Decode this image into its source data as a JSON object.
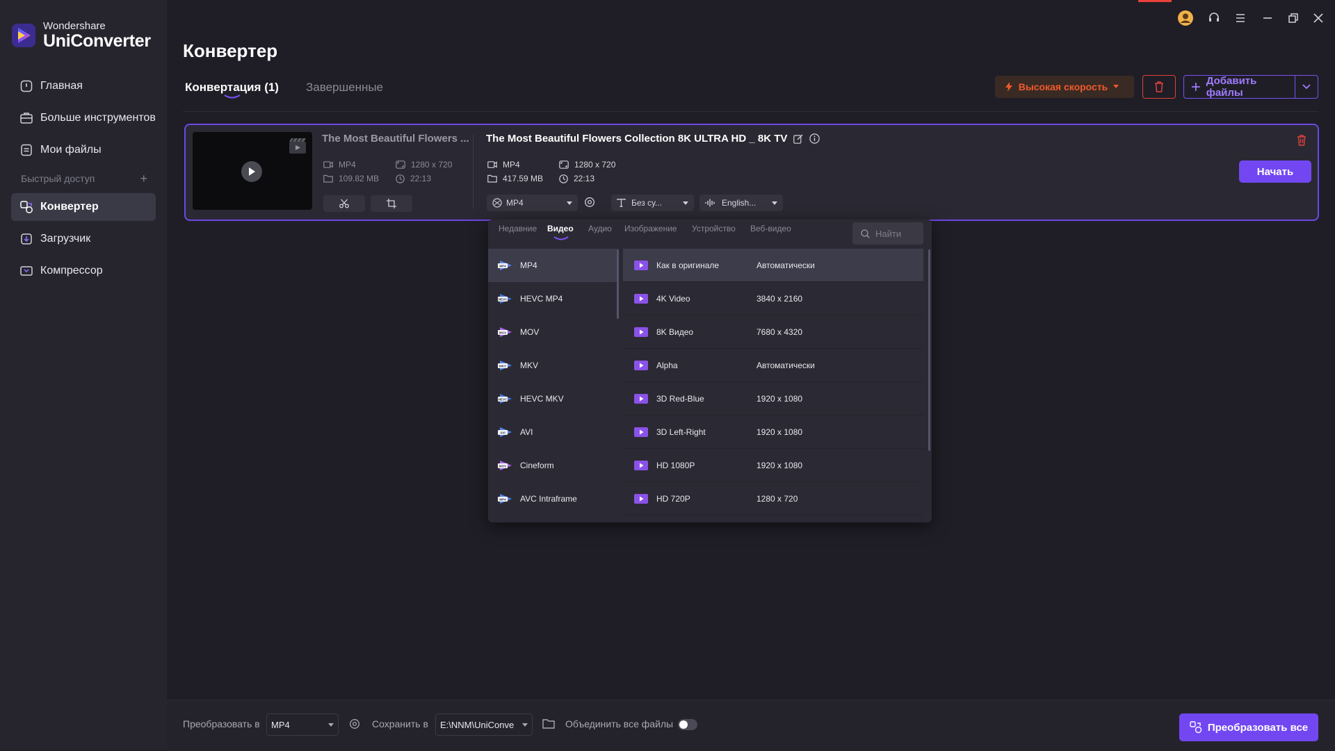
{
  "app": {
    "brand_top": "Wondershare",
    "brand_bottom": "UniConverter"
  },
  "sidebar": {
    "items": [
      {
        "label": "Главная",
        "icon": "home-icon"
      },
      {
        "label": "Больше инструментов",
        "icon": "toolbox-icon"
      },
      {
        "label": "Мои файлы",
        "icon": "files-icon"
      }
    ],
    "quick_access": "Быстрый доступ",
    "quick_items": [
      {
        "label": "Конвертер",
        "icon": "converter-icon",
        "active": true
      },
      {
        "label": "Загрузчик",
        "icon": "downloader-icon"
      },
      {
        "label": "Компрессор",
        "icon": "compressor-icon"
      }
    ]
  },
  "header": {
    "title": "Конвертер",
    "tabs": [
      {
        "label": "Конвертация (1)",
        "active": true
      },
      {
        "label": "Завершенные",
        "active": false
      }
    ],
    "speed_button": "Высокая скорость",
    "add_files_button": "Добавить файлы"
  },
  "file": {
    "source": {
      "title": "The Most Beautiful Flowers ...",
      "format": "MP4",
      "resolution": "1280 x 720",
      "size": "109.82 MB",
      "duration": "22:13"
    },
    "output": {
      "title": "The Most Beautiful Flowers Collection 8K ULTRA HD _ 8K TV",
      "format": "MP4",
      "resolution": "1280 x 720",
      "size": "417.59 MB",
      "duration": "22:13"
    },
    "format_select": "MP4",
    "subtitle_select": "Без су...",
    "audio_select": "English...",
    "start_button": "Начать"
  },
  "format_dropdown": {
    "tabs": [
      "Недавние",
      "Видео",
      "Аудио",
      "Изображение",
      "Устройство",
      "Веб-видео"
    ],
    "active_tab": "Видео",
    "search_placeholder": "Найти",
    "formats": [
      "MP4",
      "HEVC MP4",
      "MOV",
      "MKV",
      "HEVC MKV",
      "AVI",
      "Cineform",
      "AVC Intraframe"
    ],
    "format_badges": [
      "MP4",
      "HEVC",
      "MOV",
      "MKV",
      "HEVC",
      "AVI",
      "MOV",
      "MP4"
    ],
    "presets": [
      {
        "name": "Как в оригинале",
        "value": "Автоматически"
      },
      {
        "name": "4K Video",
        "value": "3840 x 2160"
      },
      {
        "name": "8K Видео",
        "value": "7680 x 4320"
      },
      {
        "name": "Alpha",
        "value": "Автоматически"
      },
      {
        "name": "3D Red-Blue",
        "value": "1920 x 1080"
      },
      {
        "name": "3D Left-Right",
        "value": "1920 x 1080"
      },
      {
        "name": "HD 1080P",
        "value": "1920 x 1080"
      },
      {
        "name": "HD 720P",
        "value": "1280 x 720"
      }
    ]
  },
  "bottom": {
    "convert_to_label": "Преобразовать в",
    "convert_to_value": "MP4",
    "save_to_label": "Сохранить в",
    "save_to_value": "E:\\NNM\\UniConve",
    "merge_label": "Объединить все файлы",
    "merge_on": false,
    "convert_all_button": "Преобразовать все"
  },
  "colors": {
    "accent": "#7247f2",
    "danger": "#e0423b",
    "speed": "#f05a2a",
    "background": "#1f1e26",
    "sidebar": "#26252e"
  }
}
